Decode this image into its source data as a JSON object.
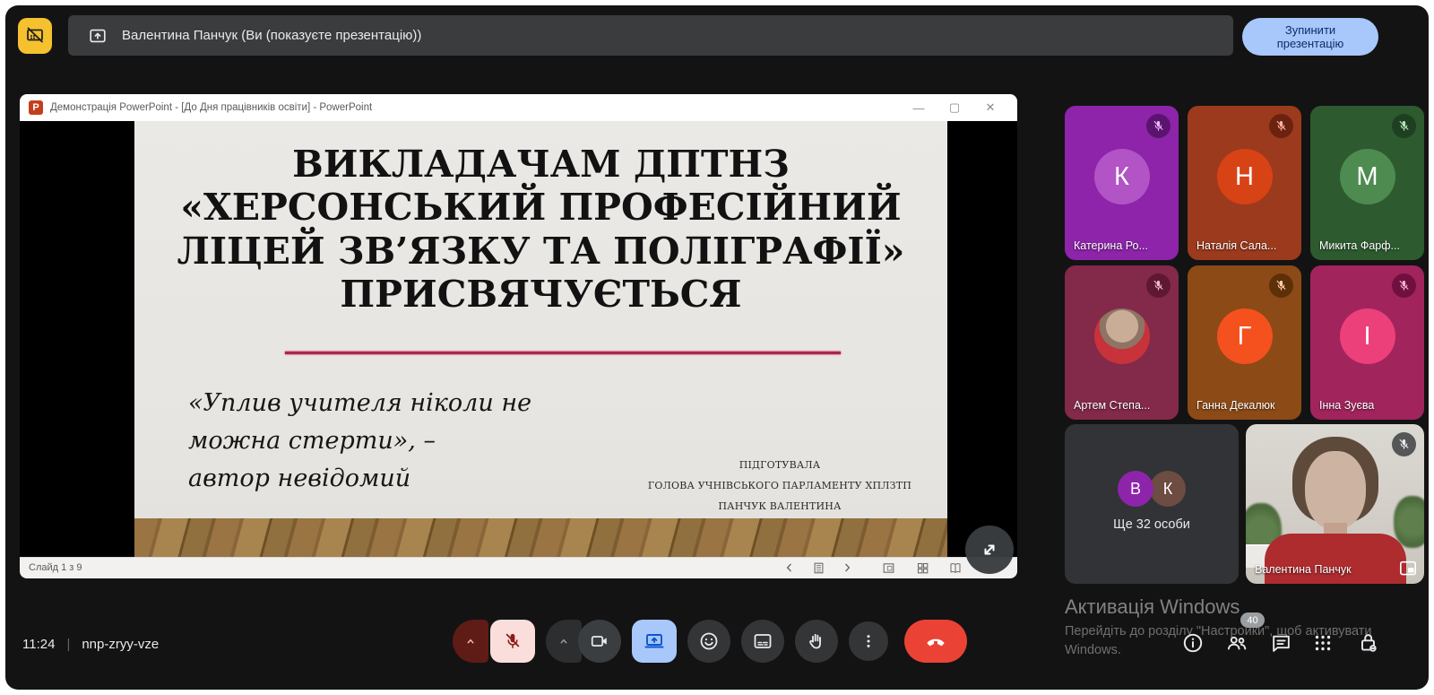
{
  "meet": {
    "top_bar": {
      "presenter_status": "Валентина Панчук (Ви (показуєте презентацію))",
      "stop_presentation_button": "Зупинити презентацію"
    },
    "bottom_bar": {
      "clock": "11:24",
      "meeting_code": "nnp-zryy-vze",
      "participants_badge": "40"
    }
  },
  "powerpoint": {
    "window_title": "Демонстрація PowerPoint - [До Дня працівників освіти] - PowerPoint",
    "logo_letter": "P",
    "status_bar": {
      "slide_counter": "Слайд 1 з 9"
    },
    "slide": {
      "title": "ВИКЛАДАЧАМ ДПТНЗ\n«ХЕРСОНСЬКИЙ ПРОФЕСІЙНИЙ\nЛІЦЕЙ ЗВ’ЯЗКУ ТА ПОЛІГРАФІЇ»\nПРИСВЯЧУЄТЬСЯ",
      "quote": "«Уплив учителя ніколи не\nможна стерти»,  –\nавтор невідомий",
      "credits_line1": "ПІДГОТУВАЛА",
      "credits_line2": "ГОЛОВА  УЧНІВСЬКОГО ПАРЛАМЕНТУ ХПЛЗТП",
      "credits_line3": "ПАНЧУК ВАЛЕНТИНА",
      "accent_line_color": "#a52948"
    }
  },
  "participants": {
    "tiles": [
      {
        "name": "Катерина Ро...",
        "initial": "К",
        "tile_color": "#8d24aa",
        "avatar_color": "#b253c6",
        "muted": true
      },
      {
        "name": "Наталія Сала...",
        "initial": "Н",
        "tile_color": "#9c3a1d",
        "avatar_color": "#d84315",
        "muted": true
      },
      {
        "name": "Микита Фарф...",
        "initial": "М",
        "tile_color": "#2d5a2f",
        "avatar_color": "#4e8b50",
        "muted": true
      },
      {
        "name": "Артем Степа...",
        "initial": "",
        "tile_color": "#83294a",
        "avatar_type": "photo",
        "muted": true
      },
      {
        "name": "Ганна Декалюк",
        "initial": "Г",
        "tile_color": "#8c4a17",
        "avatar_color": "#f4511e",
        "muted": true
      },
      {
        "name": "Інна Зуєва",
        "initial": "І",
        "tile_color": "#a1245d",
        "avatar_color": "#ec407a",
        "muted": true
      }
    ],
    "overflow_tile": {
      "label": "Ще 32 особи",
      "initial_1": "В",
      "initial_1_color": "#8e24aa",
      "initial_2": "К",
      "initial_2_color": "#6d4c41"
    },
    "self_tile": {
      "name": "Валентина Панчук",
      "muted": true
    }
  },
  "watermark": {
    "title": "Активація Windows",
    "line2": "Перейдіть до розділу \"Настройки\", щоб активувати",
    "line3": "Windows."
  },
  "colors": {
    "app_background": "#131314",
    "top_indicator_bg": "#f5c12e",
    "stop_button_bg": "#a8c7fa",
    "present_active_bg": "#a8c7fa",
    "mic_muted_bg": "#f9dedc",
    "mic_muted_accent": "#8c1d18",
    "end_call_bg": "#ea4335"
  },
  "icons": {
    "presentation-hidden-icon": "slashed screen on amber square",
    "present-screen-icon": "square with up arrow",
    "mic-off-icon": "microphone with slash",
    "camera-icon": "video camera",
    "screen-share-icon": "laptop with up arrow",
    "reactions-icon": "smiley face",
    "captions-icon": "cc box",
    "raise-hand-icon": "open hand",
    "more-options-icon": "vertical ellipsis",
    "end-call-icon": "phone handset",
    "info-icon": "circled i",
    "people-icon": "two people",
    "chat-icon": "speech bubble",
    "apps-icon": "3x3 dot grid",
    "host-controls-icon": "padlock with badge",
    "fullscreen-icon": "diagonal expand arrows",
    "pip-icon": "picture in picture"
  }
}
